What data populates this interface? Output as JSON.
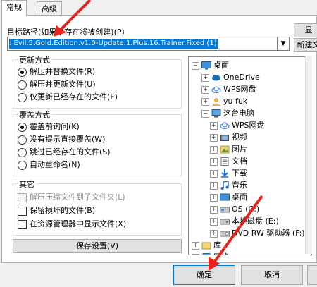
{
  "tabs": [
    {
      "label": "常规"
    },
    {
      "label": "高级"
    }
  ],
  "target_path": {
    "label": "目标路径(如果不存在将被创建)(P)",
    "value": ": Evil.5.Gold.Edition.v1.0-Update.1.Plus.16.Trainer.Fixed (1)"
  },
  "side_buttons": {
    "browse": "显",
    "new_folder": "新建文"
  },
  "update_mode": {
    "title": "更新方式",
    "options": [
      {
        "label": "解压并替换文件(R)",
        "selected": true
      },
      {
        "label": "解压并更新文件(U)",
        "selected": false
      },
      {
        "label": "仅更新已经存在的文件(F)",
        "selected": false
      }
    ]
  },
  "overwrite_mode": {
    "title": "覆盖方式",
    "options": [
      {
        "label": "覆盖前询问(K)",
        "selected": true
      },
      {
        "label": "没有提示直接覆盖(W)",
        "selected": false
      },
      {
        "label": "跳过已经存在的文件(S)",
        "selected": false
      },
      {
        "label": "自动重命名(N)",
        "selected": false
      }
    ]
  },
  "other": {
    "title": "其它",
    "options": [
      {
        "label": "解压压缩文件到子文件夹(L)",
        "checked": false,
        "disabled": true
      },
      {
        "label": "保留损坏的文件(B)",
        "checked": false,
        "disabled": false
      },
      {
        "label": "在资源管理器中显示文件(X)",
        "checked": false,
        "disabled": false
      }
    ]
  },
  "save_button": "保存设置(V)",
  "tree": {
    "items": [
      {
        "label": "桌面",
        "icon": "desktop-icon",
        "expander": "−"
      },
      {
        "label": "OneDrive",
        "icon": "cloud-icon",
        "expander": "+"
      },
      {
        "label": "WPS网盘",
        "icon": "wps-cloud-icon",
        "expander": "+"
      },
      {
        "label": "yu fuk",
        "icon": "user-icon",
        "expander": "+"
      },
      {
        "label": "这台电脑",
        "icon": "computer-icon",
        "expander": "−"
      },
      {
        "label": "WPS网盘",
        "icon": "wps-cloud-icon",
        "expander": "+"
      },
      {
        "label": "视频",
        "icon": "video-folder-icon",
        "expander": "+"
      },
      {
        "label": "图片",
        "icon": "pictures-folder-icon",
        "expander": "+"
      },
      {
        "label": "文档",
        "icon": "documents-folder-icon",
        "expander": "+"
      },
      {
        "label": "下载",
        "icon": "downloads-folder-icon",
        "expander": "+"
      },
      {
        "label": "音乐",
        "icon": "music-folder-icon",
        "expander": "+"
      },
      {
        "label": "桌面",
        "icon": "desktop-folder-icon",
        "expander": "+"
      },
      {
        "label": "OS (C:)",
        "icon": "drive-icon",
        "expander": "+"
      },
      {
        "label": "本地磁盘 (E:)",
        "icon": "drive-icon",
        "expander": "+"
      },
      {
        "label": "DVD RW 驱动器 (F:)",
        "icon": "dvd-drive-icon",
        "expander": "+"
      },
      {
        "label": "库",
        "icon": "library-icon",
        "expander": "+"
      },
      {
        "label": "网络",
        "icon": "network-icon",
        "expander": "+"
      }
    ]
  },
  "footer": {
    "ok": "确定",
    "cancel": "取消"
  },
  "colors": {
    "selection": "#0078d7",
    "arrow": "#e8231b",
    "accent_border": "#0078d7"
  }
}
